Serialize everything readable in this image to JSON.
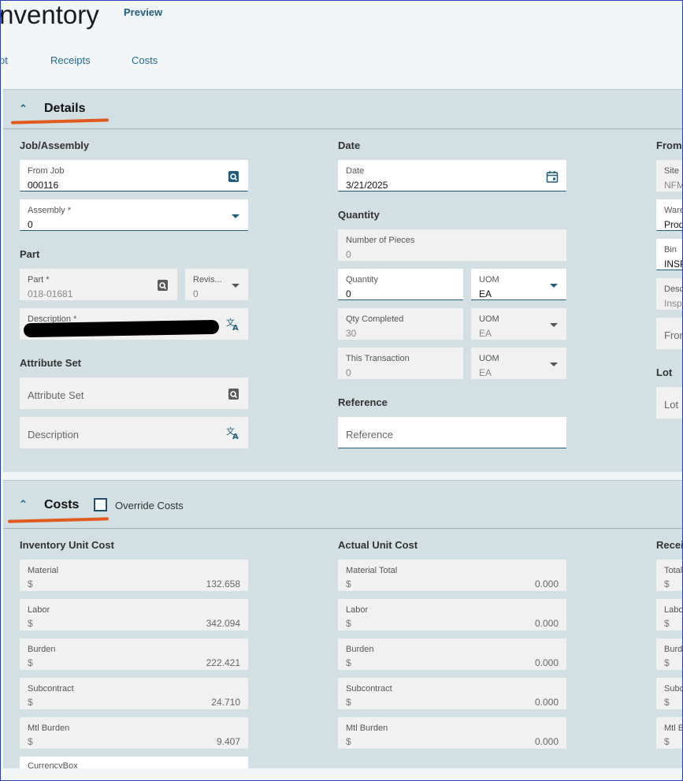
{
  "header": {
    "title": "Inventory",
    "badge": "Preview"
  },
  "tabs": [
    "pt",
    "Receipts",
    "Costs"
  ],
  "details": {
    "title": "Details",
    "job_group": "Job/Assembly",
    "from_job": {
      "label": "From Job",
      "value": "000116"
    },
    "assembly": {
      "label": "Assembly *",
      "value": "0"
    },
    "part_group": "Part",
    "part": {
      "label": "Part *",
      "value": "018-01681"
    },
    "revision": {
      "label": "Revis...",
      "value": "0"
    },
    "description": {
      "label": "Description *"
    },
    "attr_group": "Attribute Set",
    "attr_set": {
      "placeholder": "Attribute Set"
    },
    "attr_desc": {
      "placeholder": "Description"
    },
    "date_group": "Date",
    "date": {
      "label": "Date",
      "value": "3/21/2025"
    },
    "qty_group": "Quantity",
    "num_pieces": {
      "label": "Number of Pieces",
      "value": "0"
    },
    "quantity": {
      "label": "Quantity",
      "value": "0"
    },
    "uom1": {
      "label": "UOM",
      "value": "EA"
    },
    "qty_completed": {
      "label": "Qty Completed",
      "value": "30"
    },
    "uom2": {
      "label": "UOM",
      "value": "EA"
    },
    "this_trans": {
      "label": "This Transaction",
      "value": "0"
    },
    "uom3": {
      "label": "UOM",
      "value": "EA"
    },
    "ref_group": "Reference",
    "reference": {
      "placeholder": "Reference"
    },
    "from_group": "From",
    "site": {
      "label": "Site",
      "value": "NFM"
    },
    "warehouse": {
      "label": "Ware",
      "value": "Prod"
    },
    "bin": {
      "label": "Bin",
      "value": "INSP"
    },
    "desc3": {
      "label": "Desc",
      "value": "Insp"
    },
    "from_field": {
      "placeholder": "Fron"
    },
    "lot_group": "Lot",
    "lot": {
      "placeholder": "Lot"
    }
  },
  "costs": {
    "title": "Costs",
    "override_label": "Override Costs",
    "inv_group": "Inventory Unit Cost",
    "inv": [
      {
        "label": "Material",
        "currency": "$",
        "value": "132.658"
      },
      {
        "label": "Labor",
        "currency": "$",
        "value": "342.094"
      },
      {
        "label": "Burden",
        "currency": "$",
        "value": "222.421"
      },
      {
        "label": "Subcontract",
        "currency": "$",
        "value": "24.710"
      },
      {
        "label": "Mtl Burden",
        "currency": "$",
        "value": "9.407"
      },
      {
        "label": "CurrencyBox",
        "currency": "",
        "value": ""
      }
    ],
    "act_group": "Actual Unit Cost",
    "act": [
      {
        "label": "Material Total",
        "currency": "$",
        "value": "0.000"
      },
      {
        "label": "Labor",
        "currency": "$",
        "value": "0.000"
      },
      {
        "label": "Burden",
        "currency": "$",
        "value": "0.000"
      },
      {
        "label": "Subcontract",
        "currency": "$",
        "value": "0.000"
      },
      {
        "label": "Mtl Burden",
        "currency": "$",
        "value": "0.000"
      }
    ],
    "rec_group": "Receiv",
    "rec": [
      {
        "label": "Total",
        "currency": "$"
      },
      {
        "label": "Labo",
        "currency": "$"
      },
      {
        "label": "Burd",
        "currency": "$"
      },
      {
        "label": "Subc",
        "currency": "$"
      },
      {
        "label": "Mtl E",
        "currency": "$"
      }
    ]
  }
}
